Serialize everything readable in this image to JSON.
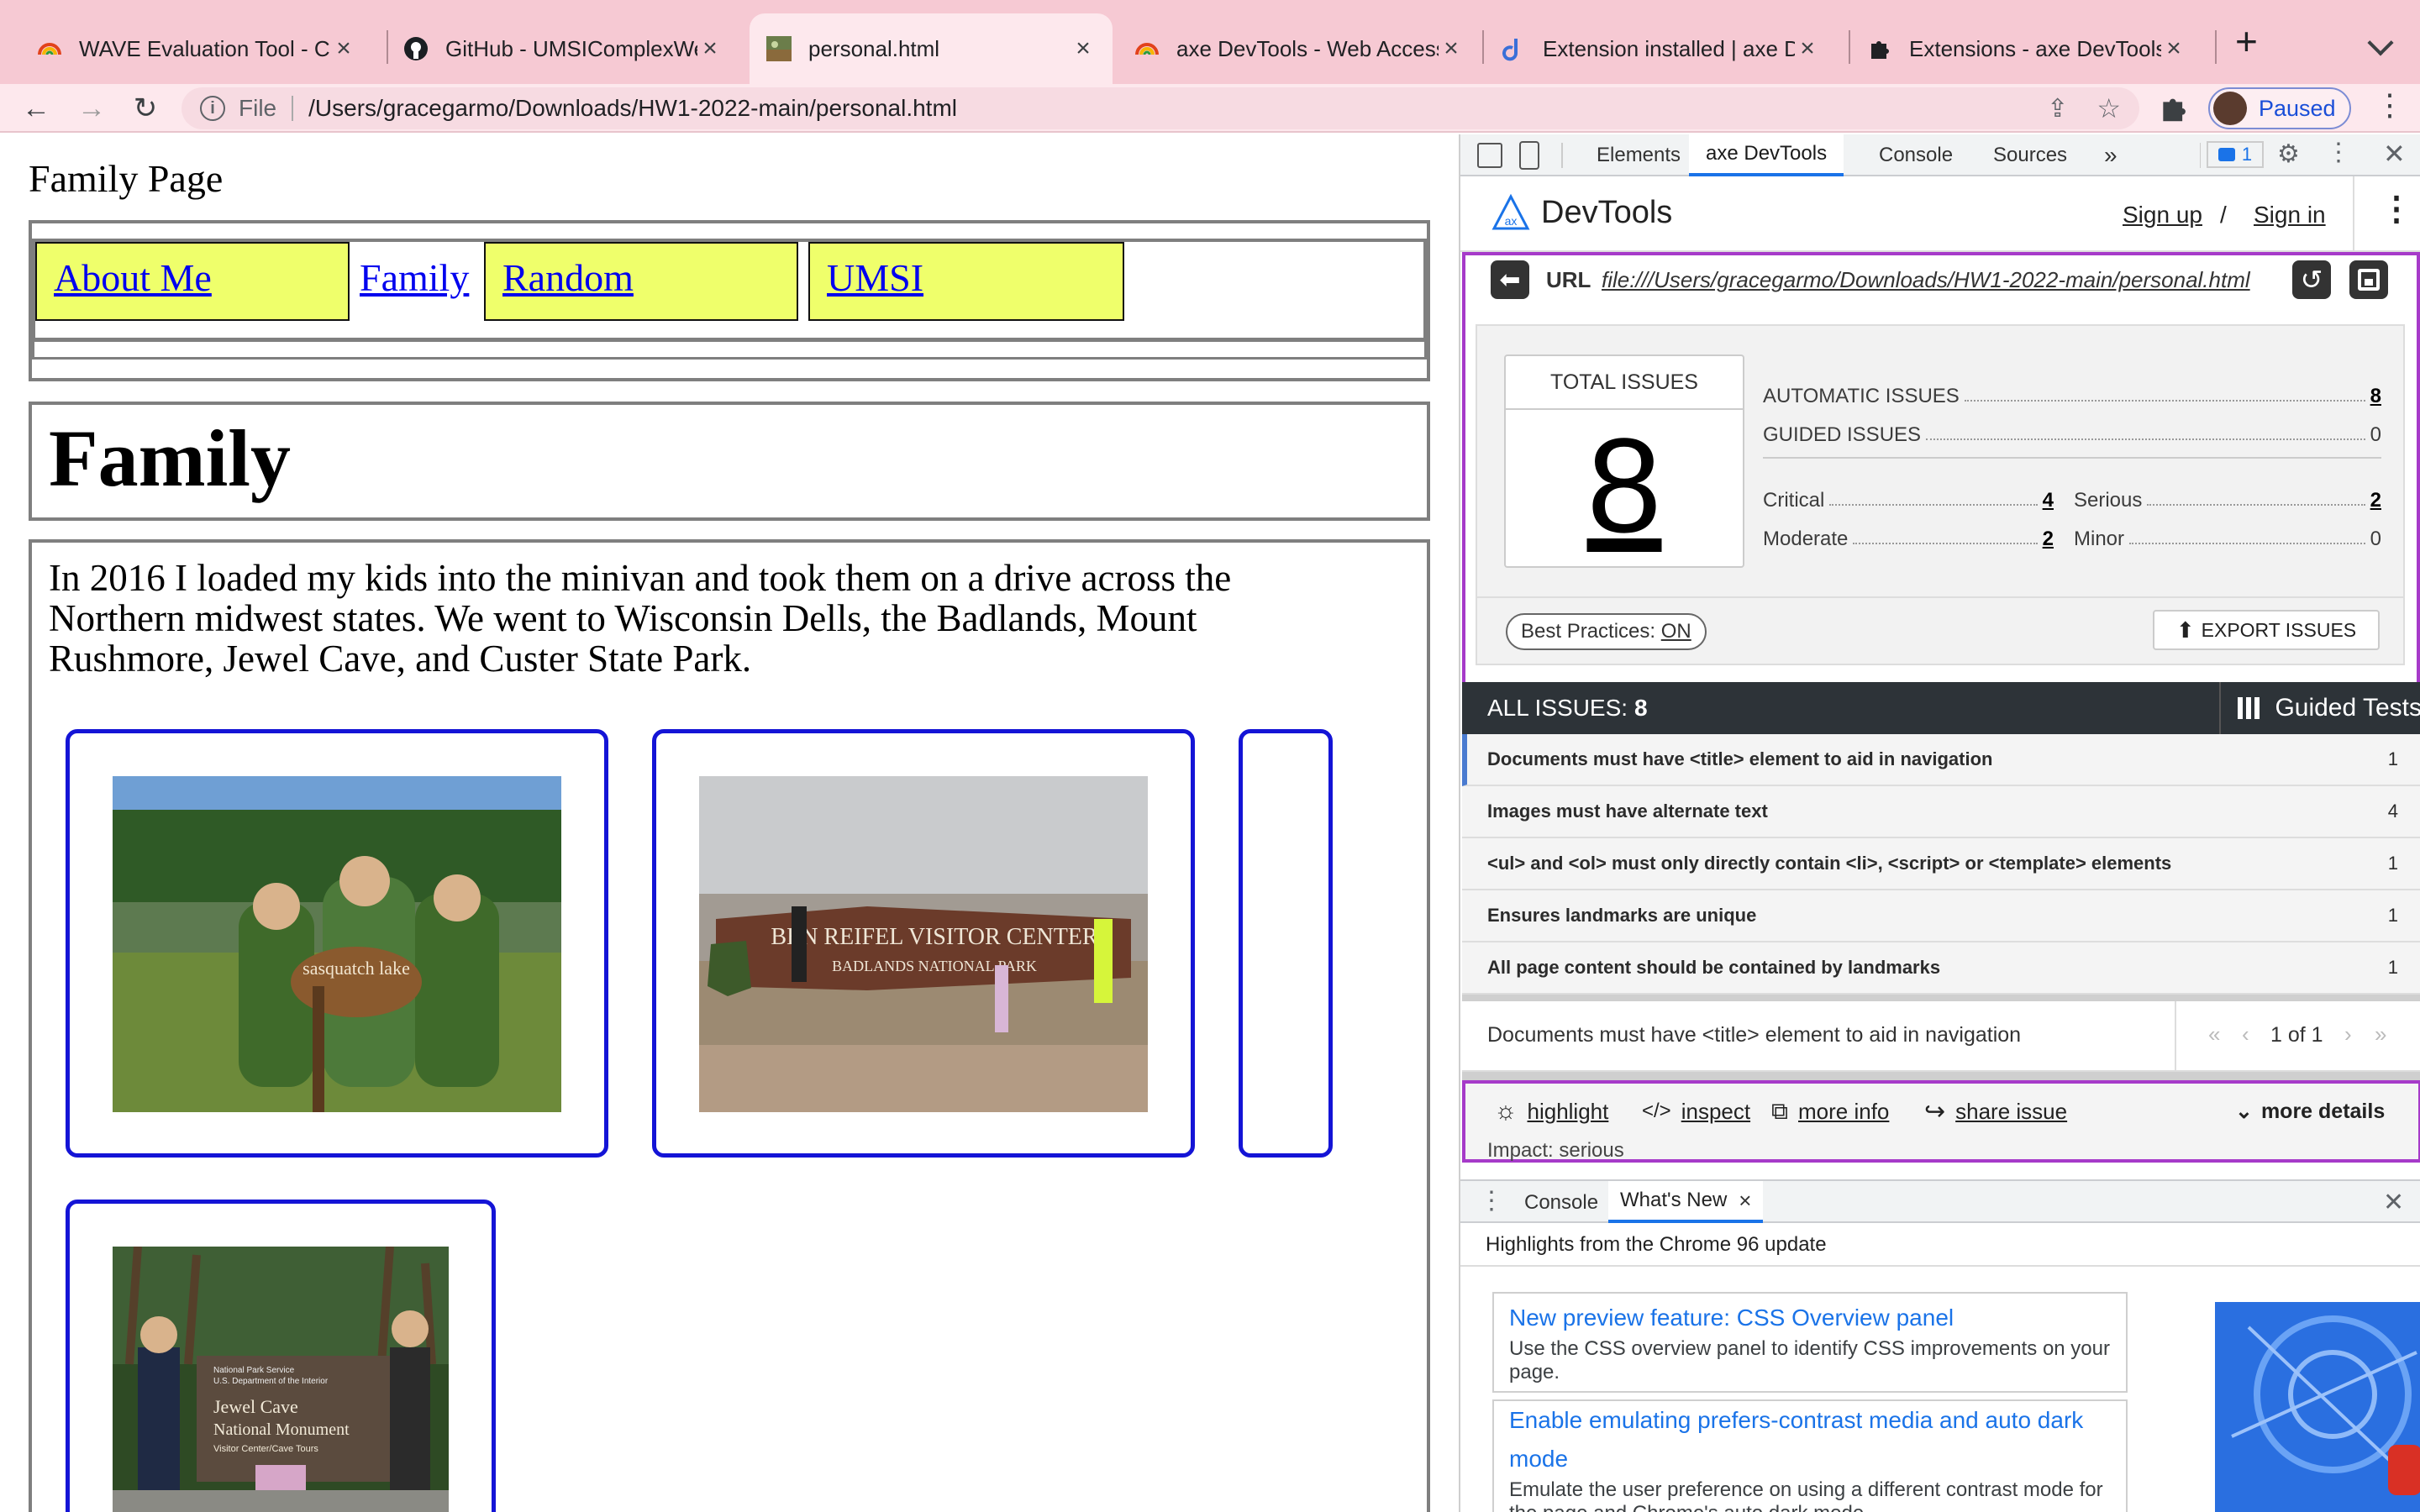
{
  "browser": {
    "tabs": [
      {
        "title": "WAVE Evaluation Tool - Chr",
        "icon": "wave-icon",
        "active": false
      },
      {
        "title": "GitHub - UMSIComplexWeb",
        "icon": "github-icon",
        "active": false
      },
      {
        "title": "personal.html",
        "icon": "photo-icon",
        "active": true
      },
      {
        "title": "axe DevTools - Web Access",
        "icon": "wave-icon",
        "active": false
      },
      {
        "title": "Extension installed | axe De",
        "icon": "deque-icon",
        "active": false
      },
      {
        "title": "Extensions - axe DevTools -",
        "icon": "puzzle-icon",
        "active": false
      }
    ],
    "new_tab": "+",
    "address": {
      "scheme_label": "File",
      "url": "/Users/gracegarmo/Downloads/HW1-2022-main/personal.html"
    },
    "profile_label": "Paused"
  },
  "page": {
    "site_title": "Family Page",
    "nav": [
      "About Me",
      "Family",
      "Random",
      "UMSI"
    ],
    "heading": "Family",
    "intro": "In 2016 I loaded my kids into the minivan and took them on a drive across the Northern midwest states. We went to Wisconsin Dells, the Badlands, Mount Rushmore, Jewel Cave, and Custer State Park.",
    "photo_signs": [
      "sasquatch lake",
      "BEN REIFEL VISITOR CENTER",
      "BADLANDS NATIONAL PARK",
      "National Park Service",
      "U.S. Department of the Interior",
      "Jewel Cave",
      "National Monument",
      "Visitor Center/Cave Tours"
    ]
  },
  "devtools": {
    "tabs": [
      "Elements",
      "axe DevTools",
      "Console",
      "Sources"
    ],
    "more_tabs": "»",
    "issues_badge": "1",
    "axe": {
      "brand": "DevTools",
      "brand_mark": "ax",
      "sign_up": "Sign up",
      "slash": "/",
      "sign_in": "Sign in",
      "url_label": "URL",
      "url": "file:///Users/gracegarmo/Downloads/HW1-2022-main/personal.html",
      "total_label": "TOTAL ISSUES",
      "total": "8",
      "automatic_label": "AUTOMATIC ISSUES",
      "automatic": "8",
      "guided_label": "GUIDED ISSUES",
      "guided": "0",
      "critical_label": "Critical",
      "critical": "4",
      "serious_label": "Serious",
      "serious": "2",
      "moderate_label": "Moderate",
      "moderate": "2",
      "minor_label": "Minor",
      "minor": "0",
      "best_practices_label": "Best Practices:",
      "best_practices_value": "ON",
      "export_label": "EXPORT ISSUES",
      "all_issues_label": "ALL ISSUES:",
      "all_issues_count": "8",
      "guided_tests_label": "Guided Tests",
      "issues": [
        {
          "title": "Documents must have <title> element to aid in navigation",
          "count": "1"
        },
        {
          "title": "Images must have alternate text",
          "count": "4"
        },
        {
          "title": "<ul> and <ol> must only directly contain <li>, <script> or <template> elements",
          "count": "1"
        },
        {
          "title": "Ensures landmarks are unique",
          "count": "1"
        },
        {
          "title": "All page content should be contained by landmarks",
          "count": "1"
        }
      ],
      "detail_title": "Documents must have <title> element to aid in navigation",
      "pager": "1 of 1",
      "actions": {
        "highlight": "highlight",
        "inspect": "inspect",
        "more_info": "more info",
        "share": "share issue",
        "more_details": "more details"
      },
      "impact_label": "Impact:",
      "impact_value": "serious"
    },
    "drawer": {
      "tabs": [
        "Console",
        "What's New"
      ],
      "headline": "Highlights from the Chrome 96 update",
      "cards": [
        {
          "title": "New preview feature: CSS Overview panel",
          "desc": "Use the CSS overview panel to identify CSS improvements on your page."
        },
        {
          "title": "Enable emulating prefers-contrast media and auto dark mode",
          "desc": "Emulate the user preference on using a different contrast mode for the page and Chrome's auto dark mode."
        }
      ]
    }
  },
  "colors": {
    "tabstrip": "#f6c9d3",
    "link": "#0000ee",
    "nav_cell": "#efff6b",
    "figure_border": "#1414d6",
    "axe_purple": "#a63ac9",
    "issues_bar": "#2d3338"
  }
}
